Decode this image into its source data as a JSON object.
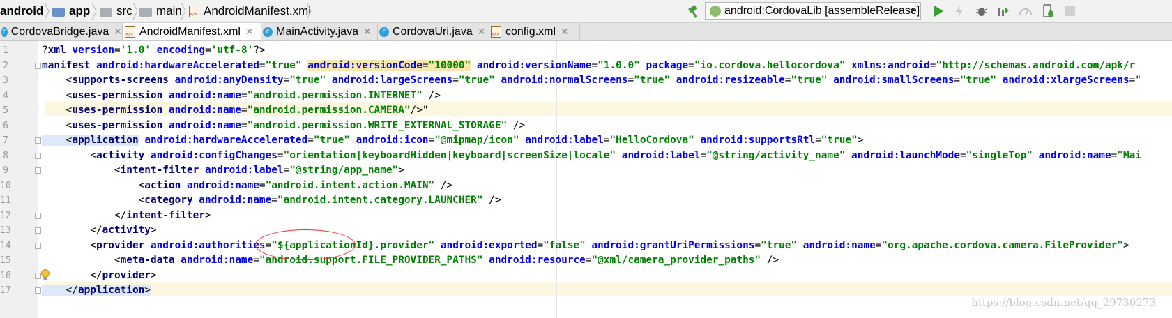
{
  "breadcrumb": [
    {
      "label": "android",
      "bold": true
    },
    {
      "label": "app",
      "bold": true
    },
    {
      "label": "src",
      "bold": false
    },
    {
      "label": "main",
      "bold": false
    },
    {
      "label": "AndroidManifest.xml",
      "bold": false
    }
  ],
  "run_config": {
    "label": "android:CordovaLib [assembleRelease]"
  },
  "toolbar_icons": [
    "hammer-icon",
    "run-icon",
    "flash-icon",
    "debug-icon",
    "coverage-icon",
    "profiler-icon",
    "attach-debugger-icon",
    "stop-icon"
  ],
  "tabs": [
    {
      "label": "CordovaBridge.java",
      "icon": "class-icon",
      "active": false
    },
    {
      "label": "AndroidManifest.xml",
      "icon": "xml-file-icon",
      "active": true
    },
    {
      "label": "MainActivity.java",
      "icon": "class-icon",
      "active": false
    },
    {
      "label": "CordovaUri.java",
      "icon": "class-icon",
      "active": false
    },
    {
      "label": "config.xml",
      "icon": "xml-file-icon",
      "active": false
    }
  ],
  "line_numbers": [
    "1",
    "2",
    "3",
    "4",
    "5",
    "6",
    "7",
    "8",
    "9",
    "10",
    "11",
    "12",
    "13",
    "14",
    "15",
    "16",
    "17"
  ],
  "watermark": "https://blog.csdn.net/qq_29730273",
  "colors": {
    "tag": "#000080",
    "attribute": "#0000ff",
    "value": "#008000",
    "annotation": "#e03535"
  },
  "code": [
    [
      [
        "pun",
        "?"
      ],
      [
        "tag",
        "xml"
      ],
      [
        "pun",
        " "
      ],
      [
        "attr",
        "version"
      ],
      [
        "pun",
        "="
      ],
      [
        "val",
        "'1.0'"
      ],
      [
        "pun",
        " "
      ],
      [
        "attr",
        "encoding"
      ],
      [
        "pun",
        "="
      ],
      [
        "val",
        "'utf-8'"
      ],
      [
        "pun",
        "?>"
      ]
    ],
    [
      [
        "tag",
        "manifest"
      ],
      [
        "pun",
        " "
      ],
      [
        "attr",
        "android:hardwareAccelerated"
      ],
      [
        "pun",
        "="
      ],
      [
        "val",
        "\"true\""
      ],
      [
        "pun",
        " "
      ],
      [
        "attr",
        "android:versionCode",
        "hl"
      ],
      [
        "pun",
        "=",
        "hl"
      ],
      [
        "val",
        "\"10000\"",
        "hl"
      ],
      [
        "pun",
        " "
      ],
      [
        "attr",
        "android:versionName"
      ],
      [
        "pun",
        "="
      ],
      [
        "val",
        "\"1.0.0\""
      ],
      [
        "pun",
        " "
      ],
      [
        "attr",
        "package"
      ],
      [
        "pun",
        "="
      ],
      [
        "val",
        "\"io.cordova.hellocordova\""
      ],
      [
        "pun",
        " "
      ],
      [
        "attr",
        "xmlns:android"
      ],
      [
        "pun",
        "="
      ],
      [
        "val",
        "\"http://schemas.android.com/apk/r"
      ]
    ],
    [
      [
        "pun",
        "    <"
      ],
      [
        "tag",
        "supports-screens"
      ],
      [
        "pun",
        " "
      ],
      [
        "attr",
        "android:anyDensity"
      ],
      [
        "pun",
        "="
      ],
      [
        "val",
        "\"true\""
      ],
      [
        "pun",
        " "
      ],
      [
        "attr",
        "android:largeScreens"
      ],
      [
        "pun",
        "="
      ],
      [
        "val",
        "\"true\""
      ],
      [
        "pun",
        " "
      ],
      [
        "attr",
        "android:normalScreens"
      ],
      [
        "pun",
        "="
      ],
      [
        "val",
        "\"true\""
      ],
      [
        "pun",
        " "
      ],
      [
        "attr",
        "android:resizeable"
      ],
      [
        "pun",
        "="
      ],
      [
        "val",
        "\"true\""
      ],
      [
        "pun",
        " "
      ],
      [
        "attr",
        "android:smallScreens"
      ],
      [
        "pun",
        "="
      ],
      [
        "val",
        "\"true\""
      ],
      [
        "pun",
        " "
      ],
      [
        "attr",
        "android:xlargeScreens"
      ],
      [
        "pun",
        "=\""
      ]
    ],
    [
      [
        "pun",
        "    <"
      ],
      [
        "tag",
        "uses-permission"
      ],
      [
        "pun",
        " "
      ],
      [
        "attr",
        "android:name"
      ],
      [
        "pun",
        "="
      ],
      [
        "val",
        "\"android.permission.INTERNET\""
      ],
      [
        "pun",
        " />"
      ]
    ],
    [
      [
        "pun",
        "    <"
      ],
      [
        "tag",
        "uses-permission"
      ],
      [
        "pun",
        " "
      ],
      [
        "attr",
        "android:name"
      ],
      [
        "pun",
        "="
      ],
      [
        "val",
        "\"android.permission.CAMERA\""
      ],
      [
        "pun",
        "/>\""
      ]
    ],
    [
      [
        "pun",
        "    <"
      ],
      [
        "tag",
        "uses-permission"
      ],
      [
        "pun",
        " "
      ],
      [
        "attr",
        "android:name"
      ],
      [
        "pun",
        "="
      ],
      [
        "val",
        "\"android.permission.WRITE_EXTERNAL_STORAGE\""
      ],
      [
        "pun",
        " />"
      ]
    ],
    [
      [
        "pun",
        "    <",
        "box"
      ],
      [
        "tag",
        "application",
        "box"
      ],
      [
        "pun",
        " "
      ],
      [
        "attr",
        "android:hardwareAccelerated"
      ],
      [
        "pun",
        "="
      ],
      [
        "val",
        "\"true\""
      ],
      [
        "pun",
        " "
      ],
      [
        "attr",
        "android:icon"
      ],
      [
        "pun",
        "="
      ],
      [
        "val",
        "\"@mipmap/icon\""
      ],
      [
        "pun",
        " "
      ],
      [
        "attr",
        "android:label"
      ],
      [
        "pun",
        "="
      ],
      [
        "val",
        "\"HelloCordova\""
      ],
      [
        "pun",
        " "
      ],
      [
        "attr",
        "android:supportsRtl"
      ],
      [
        "pun",
        "="
      ],
      [
        "val",
        "\"true\""
      ],
      [
        "pun",
        ">"
      ]
    ],
    [
      [
        "pun",
        "        <"
      ],
      [
        "tag",
        "activity"
      ],
      [
        "pun",
        " "
      ],
      [
        "attr",
        "android:configChanges"
      ],
      [
        "pun",
        "="
      ],
      [
        "val",
        "\"orientation|keyboardHidden|keyboard|screenSize|locale\""
      ],
      [
        "pun",
        " "
      ],
      [
        "attr",
        "android:label"
      ],
      [
        "pun",
        "="
      ],
      [
        "val",
        "\"@string/activity_name\""
      ],
      [
        "pun",
        " "
      ],
      [
        "attr",
        "android:launchMode"
      ],
      [
        "pun",
        "="
      ],
      [
        "val",
        "\"singleTop\""
      ],
      [
        "pun",
        " "
      ],
      [
        "attr",
        "android:name"
      ],
      [
        "pun",
        "="
      ],
      [
        "val",
        "\"Mai"
      ]
    ],
    [
      [
        "pun",
        "            <"
      ],
      [
        "tag",
        "intent-filter"
      ],
      [
        "pun",
        " "
      ],
      [
        "attr",
        "android:label"
      ],
      [
        "pun",
        "="
      ],
      [
        "val",
        "\"@string/app_name\""
      ],
      [
        "pun",
        ">"
      ]
    ],
    [
      [
        "pun",
        "                <"
      ],
      [
        "tag",
        "action"
      ],
      [
        "pun",
        " "
      ],
      [
        "attr",
        "android:name"
      ],
      [
        "pun",
        "="
      ],
      [
        "val",
        "\"android.intent.action.MAIN\""
      ],
      [
        "pun",
        " />"
      ]
    ],
    [
      [
        "pun",
        "                <"
      ],
      [
        "tag",
        "category"
      ],
      [
        "pun",
        " "
      ],
      [
        "attr",
        "android:name"
      ],
      [
        "pun",
        "="
      ],
      [
        "val",
        "\"android.intent.category.LAUNCHER\""
      ],
      [
        "pun",
        " />"
      ]
    ],
    [
      [
        "pun",
        "            </"
      ],
      [
        "tag",
        "intent-filter"
      ],
      [
        "pun",
        ">"
      ]
    ],
    [
      [
        "pun",
        "        </"
      ],
      [
        "tag",
        "activity"
      ],
      [
        "pun",
        ">"
      ]
    ],
    [
      [
        "pun",
        "        <"
      ],
      [
        "tag",
        "provider"
      ],
      [
        "pun",
        " "
      ],
      [
        "attr",
        "android:authorities"
      ],
      [
        "pun",
        "="
      ],
      [
        "val",
        "\"${applicationId}.provider\""
      ],
      [
        "pun",
        " "
      ],
      [
        "attr",
        "android:exported"
      ],
      [
        "pun",
        "="
      ],
      [
        "val",
        "\"false\""
      ],
      [
        "pun",
        " "
      ],
      [
        "attr",
        "android:grantUriPermissions"
      ],
      [
        "pun",
        "="
      ],
      [
        "val",
        "\"true\""
      ],
      [
        "pun",
        " "
      ],
      [
        "attr",
        "android:name"
      ],
      [
        "pun",
        "="
      ],
      [
        "val",
        "\"org.apache.cordova.camera.FileProvider\""
      ],
      [
        "pun",
        ">"
      ]
    ],
    [
      [
        "pun",
        "            <"
      ],
      [
        "tag",
        "meta-data"
      ],
      [
        "pun",
        " "
      ],
      [
        "attr",
        "android:name"
      ],
      [
        "pun",
        "="
      ],
      [
        "val",
        "\"android.support.FILE_PROVIDER_PATHS\""
      ],
      [
        "pun",
        " "
      ],
      [
        "attr",
        "android:resource"
      ],
      [
        "pun",
        "="
      ],
      [
        "val",
        "\"@xml/camera_provider_paths\""
      ],
      [
        "pun",
        " />"
      ]
    ],
    [
      [
        "pun",
        "        </"
      ],
      [
        "tag",
        "provider"
      ],
      [
        "pun",
        ">"
      ]
    ],
    [
      [
        "pun",
        "    </",
        "box"
      ],
      [
        "tag",
        "application",
        "box"
      ],
      [
        "pun",
        ">",
        "box"
      ]
    ]
  ]
}
